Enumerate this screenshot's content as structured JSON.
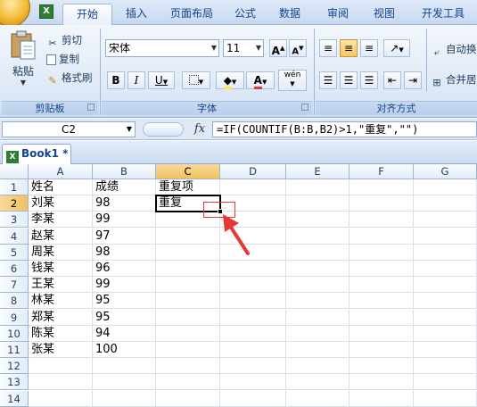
{
  "ribbon_tabs": [
    "开始",
    "插入",
    "页面布局",
    "公式",
    "数据",
    "审阅",
    "视图",
    "开发工具"
  ],
  "clipboard": {
    "paste": "粘贴",
    "cut": "剪切",
    "copy": "复制",
    "format_painter": "格式刷",
    "group_label": "剪贴板"
  },
  "font": {
    "name": "宋体",
    "size": "11",
    "bold": "B",
    "italic": "I",
    "underline": "U",
    "grow": "A",
    "shrink": "A",
    "font_color_letter": "A",
    "phonetic": "wén",
    "group_label": "字体"
  },
  "alignment": {
    "wrap_text": "自动换",
    "merge_center": "合并居",
    "group_label": "对齐方式"
  },
  "formula_bar": {
    "name_box": "C2",
    "fx": "fx",
    "formula": "=IF(COUNTIF(B:B,B2)>1,\"重复\",\"\")"
  },
  "workbook_tab": "Book1 *",
  "columns": [
    "A",
    "B",
    "C",
    "D",
    "E",
    "F",
    "G"
  ],
  "rows": [
    {
      "num": "1",
      "a": "姓名",
      "b": "成绩",
      "c": "重复项"
    },
    {
      "num": "2",
      "a": "刘某",
      "b": "98",
      "c": "重复"
    },
    {
      "num": "3",
      "a": "李某",
      "b": "99",
      "c": ""
    },
    {
      "num": "4",
      "a": "赵某",
      "b": "97",
      "c": ""
    },
    {
      "num": "5",
      "a": "周某",
      "b": "98",
      "c": ""
    },
    {
      "num": "6",
      "a": "钱某",
      "b": "96",
      "c": ""
    },
    {
      "num": "7",
      "a": "王某",
      "b": "99",
      "c": ""
    },
    {
      "num": "8",
      "a": "林某",
      "b": "95",
      "c": ""
    },
    {
      "num": "9",
      "a": "郑某",
      "b": "95",
      "c": ""
    },
    {
      "num": "10",
      "a": "陈某",
      "b": "94",
      "c": ""
    },
    {
      "num": "11",
      "a": "张某",
      "b": "100",
      "c": ""
    },
    {
      "num": "12",
      "a": "",
      "b": "",
      "c": ""
    },
    {
      "num": "13",
      "a": "",
      "b": "",
      "c": ""
    },
    {
      "num": "14",
      "a": "",
      "b": "",
      "c": ""
    }
  ],
  "colors": {
    "selection": "#000000",
    "annotation": "#e53935",
    "header_selected": "#f1c15f"
  }
}
